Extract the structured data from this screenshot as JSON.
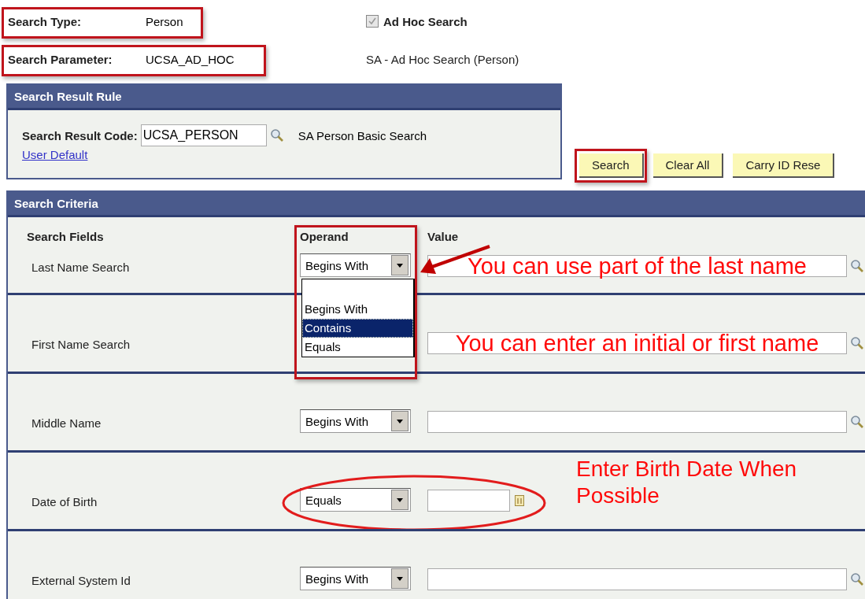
{
  "search_type": {
    "label": "Search Type:",
    "value": "Person",
    "highlighted": true
  },
  "ad_hoc": {
    "label": "Ad Hoc Search",
    "checked": true,
    "disabled": true
  },
  "search_parameter": {
    "label": "Search Parameter:",
    "value": "UCSA_AD_HOC",
    "highlighted": true,
    "description": "SA - Ad Hoc Search (Person)"
  },
  "result_rule": {
    "title": "Search Result Rule",
    "code_label": "Search Result Code:",
    "code_value": "UCSA_PERSON",
    "code_description": "SA Person Basic Search",
    "link": "User Default"
  },
  "buttons": [
    {
      "label": "Search",
      "highlighted": true
    },
    {
      "label": "Clear All"
    },
    {
      "label": "Carry ID Rese"
    }
  ],
  "criteria": {
    "title": "Search Criteria",
    "columns": [
      "Search Fields",
      "Operand",
      "Value"
    ],
    "operand_highlighted": true,
    "operand_dropdown_open": true,
    "operand_options": [
      {
        "label": "Begins With",
        "selected": false
      },
      {
        "label": "Contains",
        "selected": true
      },
      {
        "label": "Equals",
        "selected": false
      }
    ],
    "rows": [
      {
        "kind": "text",
        "label": "Last Name Search",
        "operand": "Begins With",
        "annotation": "You can use part of the last name"
      },
      {
        "kind": "text",
        "label": "First Name Search",
        "annotation": "You can enter an initial or first name"
      },
      {
        "kind": "text",
        "label": "Middle Name",
        "operand": "Begins With"
      },
      {
        "kind": "date",
        "label": "Date of Birth",
        "operand": "Equals",
        "circled": true,
        "annotation": "Enter Birth Date When Possible"
      },
      {
        "kind": "text",
        "label": "External System Id",
        "operand": "Begins With"
      }
    ]
  }
}
